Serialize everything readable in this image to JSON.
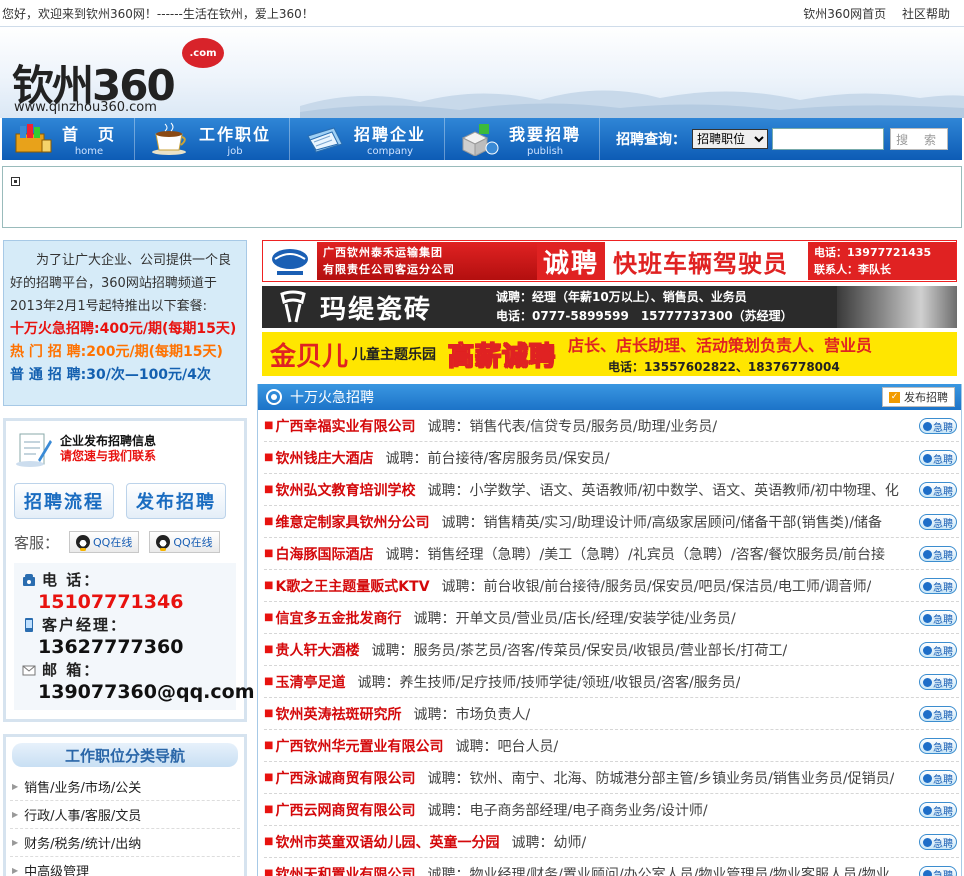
{
  "topbar": {
    "welcome": "您好，欢迎来到钦州360网！------生活在钦州，爱上360！",
    "links": [
      "钦州360网首页",
      "社区帮助"
    ]
  },
  "logo": {
    "name": "钦州360",
    "badge": ".com",
    "url": "www.qinzhou360.com"
  },
  "nav": {
    "items": [
      {
        "cn": "首　页",
        "en": "home",
        "icon": "books-icon"
      },
      {
        "cn": "工作职位",
        "en": "job",
        "icon": "coffee-cup-icon"
      },
      {
        "cn": "招聘企业",
        "en": "company",
        "icon": "documents-icon"
      },
      {
        "cn": "我要招聘",
        "en": "publish",
        "icon": "cubes-icon"
      }
    ],
    "search_label": "招聘查询：",
    "search_option": "招聘职位",
    "search_button": "搜 索"
  },
  "promo": {
    "intro": "为了让广大企业、公司提供一个良好的招聘平台，360网站招聘频道于2013年2月1号起特推出以下套餐:",
    "lines": [
      {
        "label": "十万火急招聘:",
        "price": "400元/期(每期15天)"
      },
      {
        "label": "热 门 招 聘:",
        "price": "200元/期(每期15天)"
      },
      {
        "label": "普 通 招 聘:",
        "price": "30/次—100元/4次"
      }
    ]
  },
  "contact": {
    "title": "企业发布招聘信息",
    "subtitle": "请您速与我们联系",
    "btn_flow": "招聘流程",
    "btn_publish": "发布招聘",
    "kefu_label": "客服：",
    "qq_label": "QQ在线",
    "tel_label": "电 话：",
    "tel": "15107771346",
    "manager_label": "客户经理：",
    "manager": "13627777360",
    "email_label": "邮 箱：",
    "email": "139077360@qq.com"
  },
  "catnav": {
    "title": "工作职位分类导航",
    "items": [
      "销售/业务/市场/公关",
      "行政/人事/客服/文员",
      "财务/税务/统计/出纳",
      "中高级管理"
    ]
  },
  "banners": {
    "b1_company_l1": "广西钦州泰禾运输集团",
    "b1_company_l2": "有限责任公司客运分公司",
    "b1_hire": "诚聘",
    "b1_role": "快班车辆驾驶员",
    "b1_phone": "电话：13977721435",
    "b1_contact": "联系人：李队长",
    "b2_name": "玛缇瓷砖",
    "b2_line1": "诚聘：经理（年薪10万以上）、销售员、业务员",
    "b2_line2": "电话：0777-5899599　15777737300（苏经理）",
    "b3_name": "金贝儿",
    "b3_sub": "儿童主题乐园",
    "b3_hire": "高薪诚聘",
    "b3_roles": "店长、店长助理、活动策划负责人、营业员",
    "b3_phone": "电话：13557602822、18376778004"
  },
  "urgent": {
    "title": "十万火急招聘",
    "publish": "发布招聘",
    "tag": "急聘",
    "jobs": [
      {
        "company": "广西幸福实业有限公司",
        "positions": "诚聘：销售代表/信贷专员/服务员/助理/业务员/"
      },
      {
        "company": "钦州钱庄大酒店",
        "positions": "诚聘：前台接待/客房服务员/保安员/"
      },
      {
        "company": "钦州弘文教育培训学校",
        "positions": "诚聘：小学数学、语文、英语教师/初中数学、语文、英语教师/初中物理、化"
      },
      {
        "company": "维意定制家具钦州分公司",
        "positions": "诚聘：销售精英/实习/助理设计师/高级家居顾问/储备干部(销售类)/储备"
      },
      {
        "company": "白海豚国际酒店",
        "positions": "诚聘：销售经理（急聘）/美工（急聘）/礼宾员（急聘）/咨客/餐饮服务员/前台接"
      },
      {
        "company": "K歌之王主题量贩式KTV",
        "positions": "诚聘：前台收银/前台接待/服务员/保安员/吧员/保洁员/电工师/调音师/"
      },
      {
        "company": "信宜多五金批发商行",
        "positions": "诚聘：开单文员/营业员/店长/经理/安装学徒/业务员/"
      },
      {
        "company": "贵人轩大酒楼",
        "positions": "诚聘：服务员/茶艺员/咨客/传菜员/保安员/收银员/营业部长/打荷工/"
      },
      {
        "company": "玉清亭足道",
        "positions": "诚聘：养生技师/足疗技师/技师学徒/领班/收银员/咨客/服务员/"
      },
      {
        "company": "钦州英涛祛斑研究所",
        "positions": "诚聘：市场负责人/"
      },
      {
        "company": "广西钦州华元置业有限公司",
        "positions": "诚聘：吧台人员/"
      },
      {
        "company": "广西泳诚商贸有限公司",
        "positions": "诚聘：钦州、南宁、北海、防城港分部主管/乡镇业务员/销售业务员/促销员/"
      },
      {
        "company": "广西云网商贸有限公司",
        "positions": "诚聘：电子商务部经理/电子商务业务/设计师/"
      },
      {
        "company": "钦州市英童双语幼儿园、英童一分园",
        "positions": "诚聘：幼师/"
      },
      {
        "company": "钦州天和置业有限公司",
        "positions": "诚聘：物业经理/财务/置业顾问/办公室人员/物业管理员/物业客服人员/物业"
      }
    ]
  },
  "colors": {
    "nav_blue": "#0d5cb5",
    "accent_red": "#d4090b",
    "promo_bg": "#d6ebf8"
  }
}
